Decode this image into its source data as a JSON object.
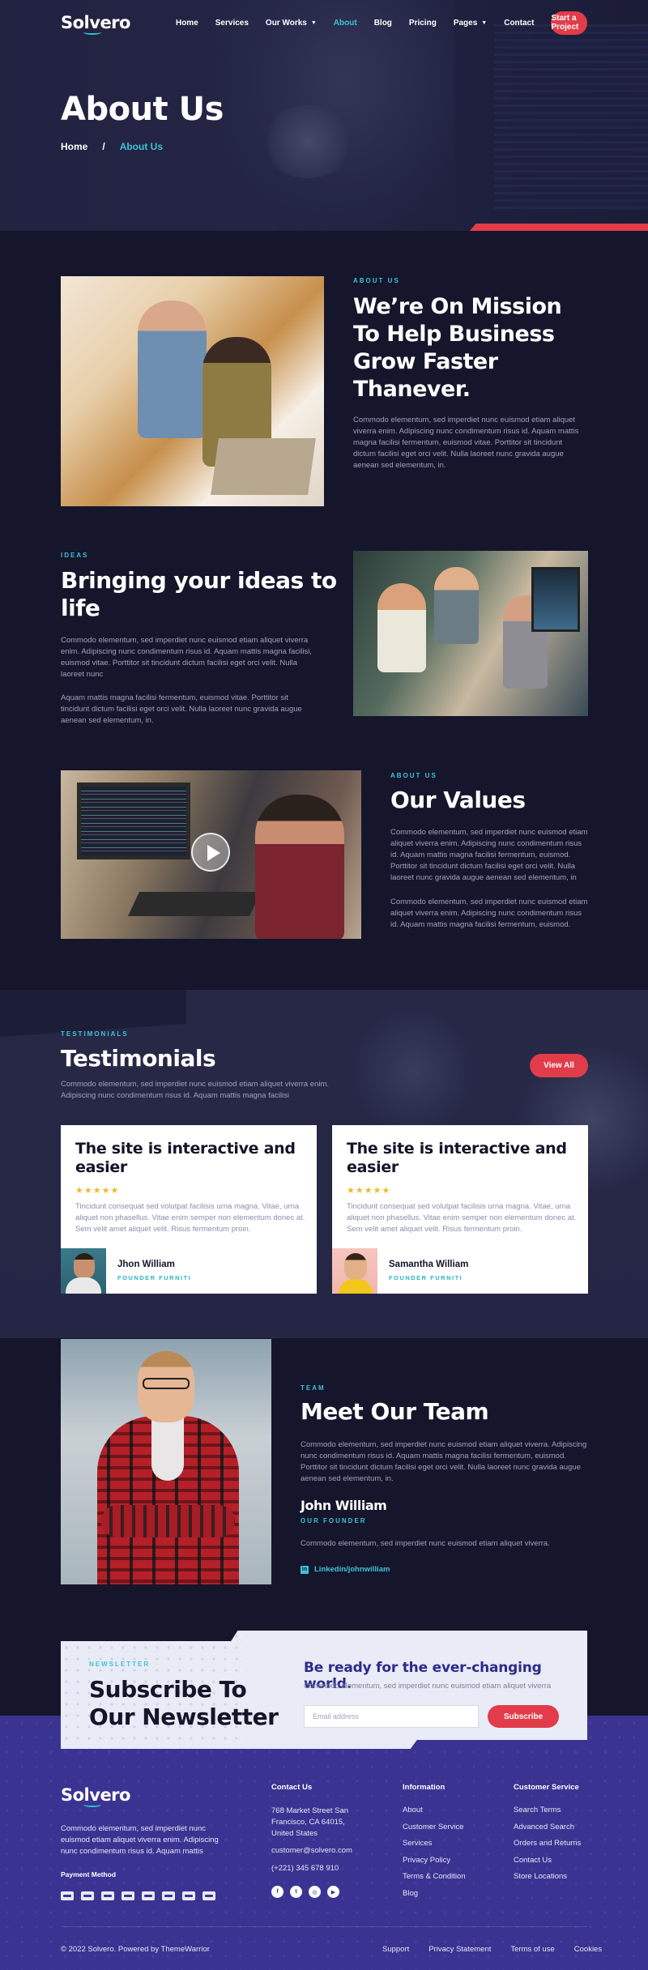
{
  "header": {
    "logo": "Solvero",
    "nav": [
      {
        "label": "Home"
      },
      {
        "label": "Services"
      },
      {
        "label": "Our Works",
        "caret": true
      },
      {
        "label": "About",
        "active": true
      },
      {
        "label": "Blog"
      },
      {
        "label": "Pricing"
      },
      {
        "label": "Pages",
        "caret": true
      },
      {
        "label": "Contact"
      }
    ],
    "cta": "Start a Project"
  },
  "hero": {
    "title": "About Us",
    "breadcrumb": {
      "home": "Home",
      "sep": "/",
      "current": "About Us"
    }
  },
  "about": {
    "eyebrow": "ABOUT US",
    "title_lines": [
      "We’re On Mission",
      "To Help Business",
      "Grow Faster",
      "Thanever."
    ],
    "body": "Commodo elementum, sed imperdiet nunc euismod etiam aliquet viverra enim. Adipiscing nunc condimentum risus id. Aquam mattis magna facilisi fermentum, euismod vitae. Porttitor sit tincidunt dictum facilisi eget orci velit. Nulla laoreet nunc gravida augue aenean sed elementum, in."
  },
  "ideas": {
    "eyebrow": "IDEAS",
    "title_lines": [
      "Bringing your ideas to",
      "life"
    ],
    "body1": "Commodo elementum, sed imperdiet nunc euismod etiam aliquet viverra enim. Adipiscing nunc condimentum risus id. Aquam mattis magna facilisi, euismod vitae. Porttitor sit tincidunt dictum facilisi eget orci velit. Nulla laoreet nunc",
    "body2": "Aquam mattis magna facilisi fermentum, euismod vitae. Porttitor sit tincidunt dictum facilisi eget orci velit. Nulla laoreet nunc gravida augue aenean sed elementum, in."
  },
  "values": {
    "eyebrow": "ABOUT US",
    "title": "Our Values",
    "body1": "Commodo elementum, sed imperdiet nunc euismod etiam aliquet viverra enim. Adipiscing nunc condimentum risus id. Aquam mattis magna facilisi fermentum, euismod. Porttitor sit tincidunt dictum facilisi eget orci velit. Nulla laoreet nunc gravida augue aenean sed elementum, in",
    "body2": "Commodo elementum, sed imperdiet nunc euismod etiam aliquet viverra enim. Adipiscing nunc condimentum risus id. Aquam mattis magna facilisi fermentum, euismod."
  },
  "testimonials": {
    "eyebrow": "TESTIMONIALS",
    "title": "Testimonials",
    "intro": "Commodo elementum, sed imperdiet nunc euismod etiam aliquet viverra enim. Adipiscing nunc condimentum risus id. Aquam mattis magna facilisi",
    "view_all": "View All",
    "cards": [
      {
        "title": "The site is interactive and easier",
        "stars": "★★★★★",
        "quote": "Tincidunt consequat sed volutpat facilisis urna magna. Vitae, urna aliquet non phasellus. Vitae enim semper non elementum donec at. Sem velit amet aliquet velit. Risus fermentum proin.",
        "name": "Jhon William",
        "role": "FOUNDER FURNITI"
      },
      {
        "title": "The site is interactive and easier",
        "stars": "★★★★★",
        "quote": "Tincidunt consequat sed volutpat facilisis urna magna. Vitae, urna aliquet non phasellus. Vitae enim semper non elementum donec at. Sem velit amet aliquet velit. Risus fermentum proin.",
        "name": "Samantha William",
        "role": "FOUNDER FURNITI"
      }
    ]
  },
  "team": {
    "eyebrow": "TEAM",
    "title": "Meet Our Team",
    "body": "Commodo elementum, sed imperdiet nunc euismod etiam aliquet viverra. Adipiscing nunc condimentum risus id. Aquam mattis magna facilisi fermentum, euismod. Porttitor sit tincidunt dictum facilisi eget orci velit. Nulla laoreet nunc gravida augue aenean sed elementum, in.",
    "member_name": "John William",
    "member_role": "OUR FOUNDER",
    "member_bio": "Commodo elementum, sed imperdiet nunc euismod etiam aliquet viverra.",
    "linkedin": "Linkedin/johnwilliam"
  },
  "newsletter": {
    "eyebrow": "NEWSLETTER",
    "title_lines": [
      "Subscribe To",
      "Our Newsletter"
    ],
    "right_title": "Be ready for the ever-changing world.",
    "right_sub": "Commodo elementum, sed imperdiet nunc euismod etiam aliquet viverra",
    "placeholder": "Email address",
    "button": "Subscribe"
  },
  "footer": {
    "logo": "Solvero",
    "about": "Commodo elementum, sed imperdiet nunc euismod etiam aliquet viverra enim. Adipiscing nunc condimentum risus id. Aquam mattis",
    "payment_title": "Payment Method",
    "payment_icons": [
      "visa",
      "mastercard",
      "amex",
      "paypal",
      "discover",
      "stripe",
      "jcb",
      "diners"
    ],
    "contact": {
      "title": "Contact Us",
      "address": "768 Market Street San Francisco, CA 64015, United States",
      "email": "customer@solvero.com",
      "phone": "(+221) 345 678 910",
      "social": [
        "facebook-icon",
        "twitter-icon",
        "instagram-icon",
        "youtube-icon"
      ]
    },
    "information": {
      "title": "Information",
      "links": [
        "About",
        "Customer Service",
        "Services",
        "Privacy Policy",
        "Terms & Condition",
        "Blog"
      ]
    },
    "customer_service": {
      "title": "Customer Service",
      "links": [
        "Search Terms",
        "Advanced Search",
        "Orders and Returns",
        "Contact Us",
        "Store Locations"
      ]
    },
    "copyright": "© 2022 Solvero. Powered by ThemeWarrior",
    "bottom_links": [
      "Support",
      "Privacy Statement",
      "Terms of use",
      "Cookies"
    ]
  },
  "colors": {
    "accent_red": "#e23b4a",
    "accent_cyan": "#3ec3d6",
    "bg_dark": "#15152b",
    "bg_blue": "#3b3392"
  }
}
